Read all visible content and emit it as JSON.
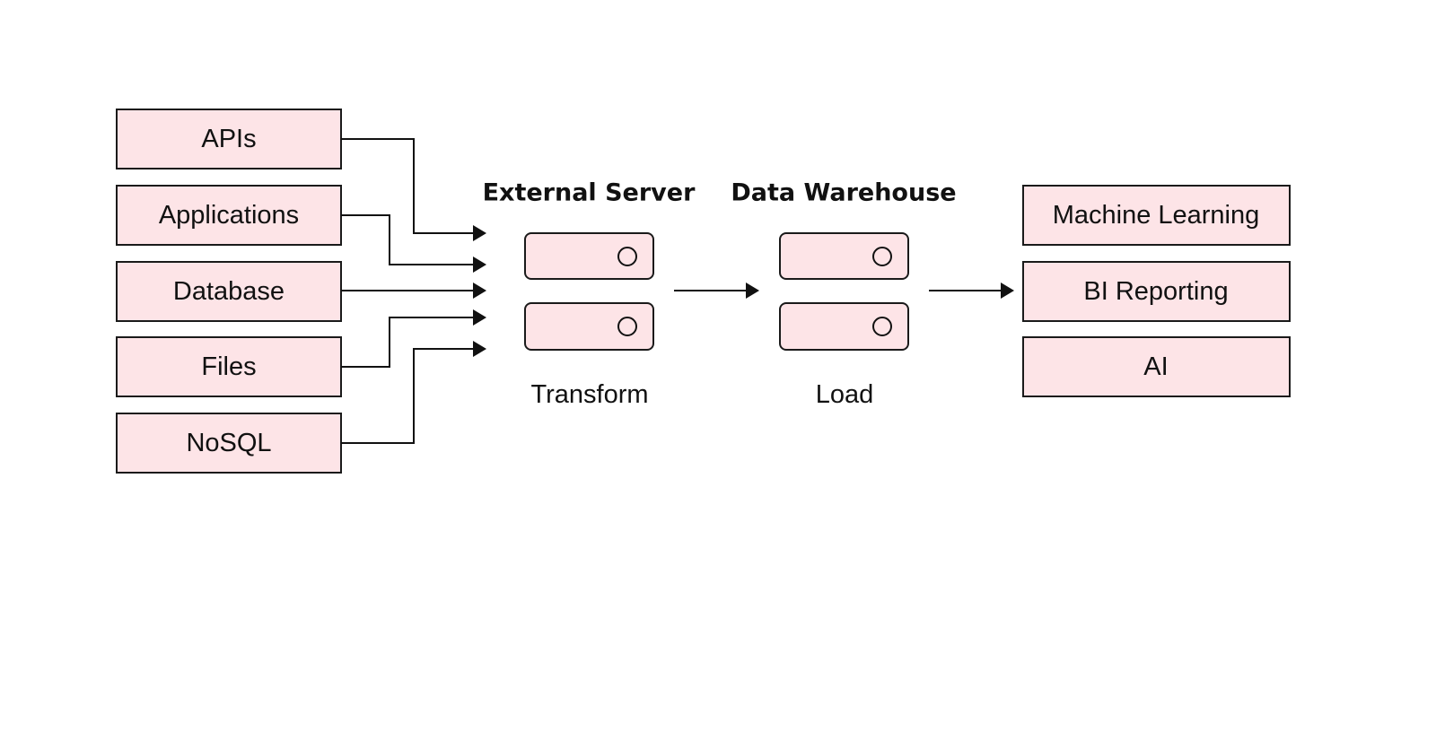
{
  "diagram": {
    "sources": [
      "APIs",
      "Applications",
      "Database",
      "Files",
      "NoSQL"
    ],
    "stages": [
      {
        "title": "External Server",
        "caption": "Transform"
      },
      {
        "title": "Data Warehouse",
        "caption": "Load"
      }
    ],
    "destinations": [
      "Machine Learning",
      "BI Reporting",
      "AI"
    ],
    "colors": {
      "box_fill": "#fde4e7",
      "stroke": "#111111"
    }
  }
}
